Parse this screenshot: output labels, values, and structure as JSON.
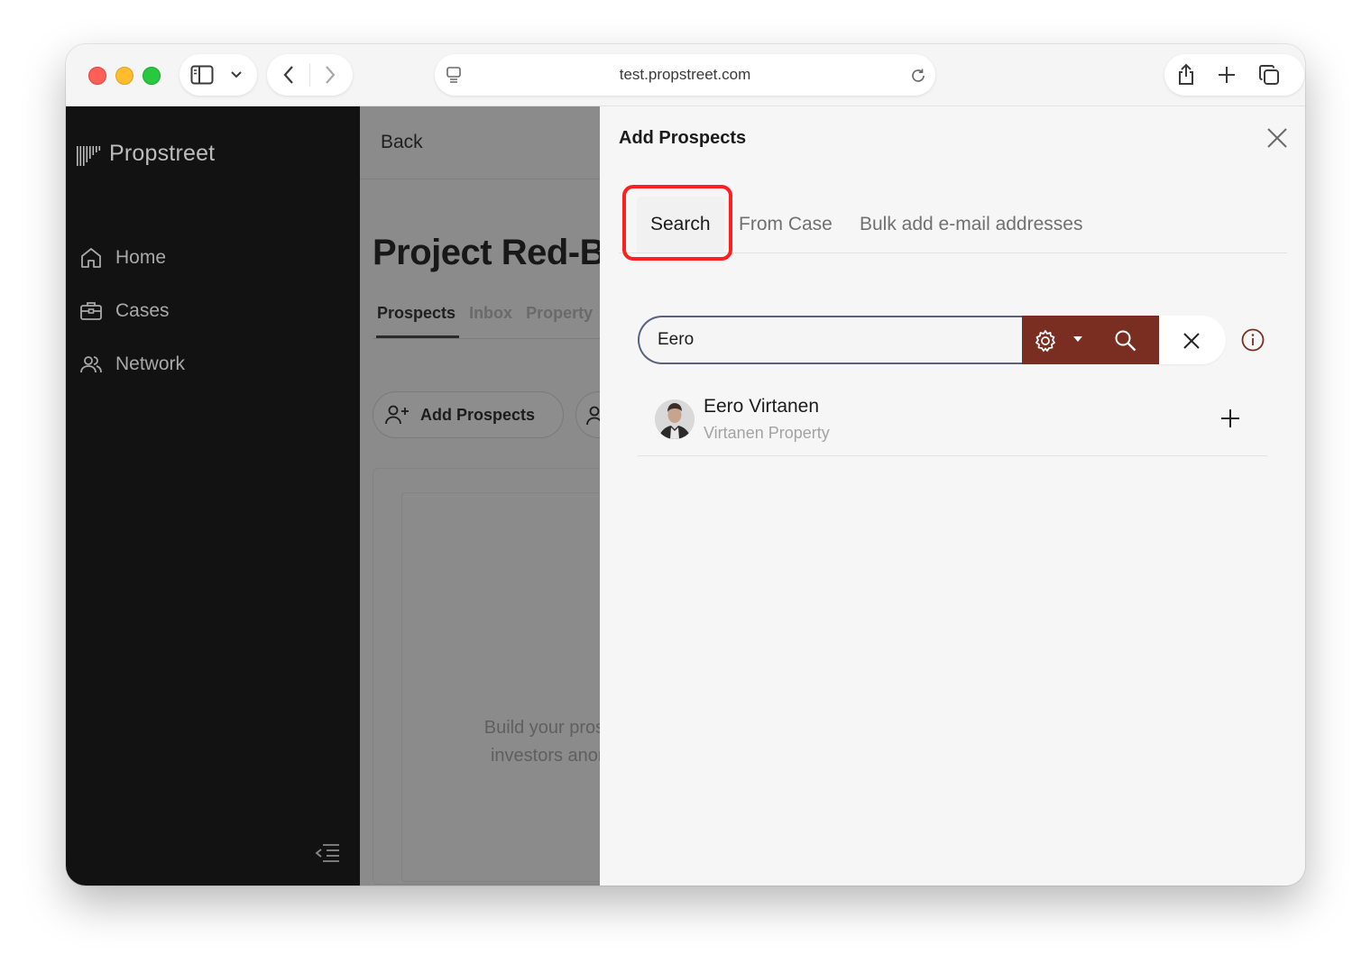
{
  "browser": {
    "url": "test.propstreet.com"
  },
  "app": {
    "logo_text": "Propstreet",
    "nav": [
      {
        "label": "Home",
        "icon": "home-icon"
      },
      {
        "label": "Cases",
        "icon": "briefcase-icon"
      },
      {
        "label": "Network",
        "icon": "people-icon"
      }
    ]
  },
  "main": {
    "back_label": "Back",
    "project_title": "Project Red-Bl",
    "tabs": [
      "Prospects",
      "Inbox",
      "Property"
    ],
    "active_tab": "Prospects",
    "add_prospects_label": "Add Prospects",
    "empty_line1": "Build your prosp",
    "empty_line2": "investors anon"
  },
  "panel": {
    "title": "Add Prospects",
    "tabs": [
      "Search",
      "From Case",
      "Bulk add e-mail addresses"
    ],
    "active_tab": "Search",
    "search_value": "Eero",
    "accent_color": "#7a2e22",
    "results": [
      {
        "name": "Eero Virtanen",
        "company": "Virtanen Property"
      }
    ]
  }
}
